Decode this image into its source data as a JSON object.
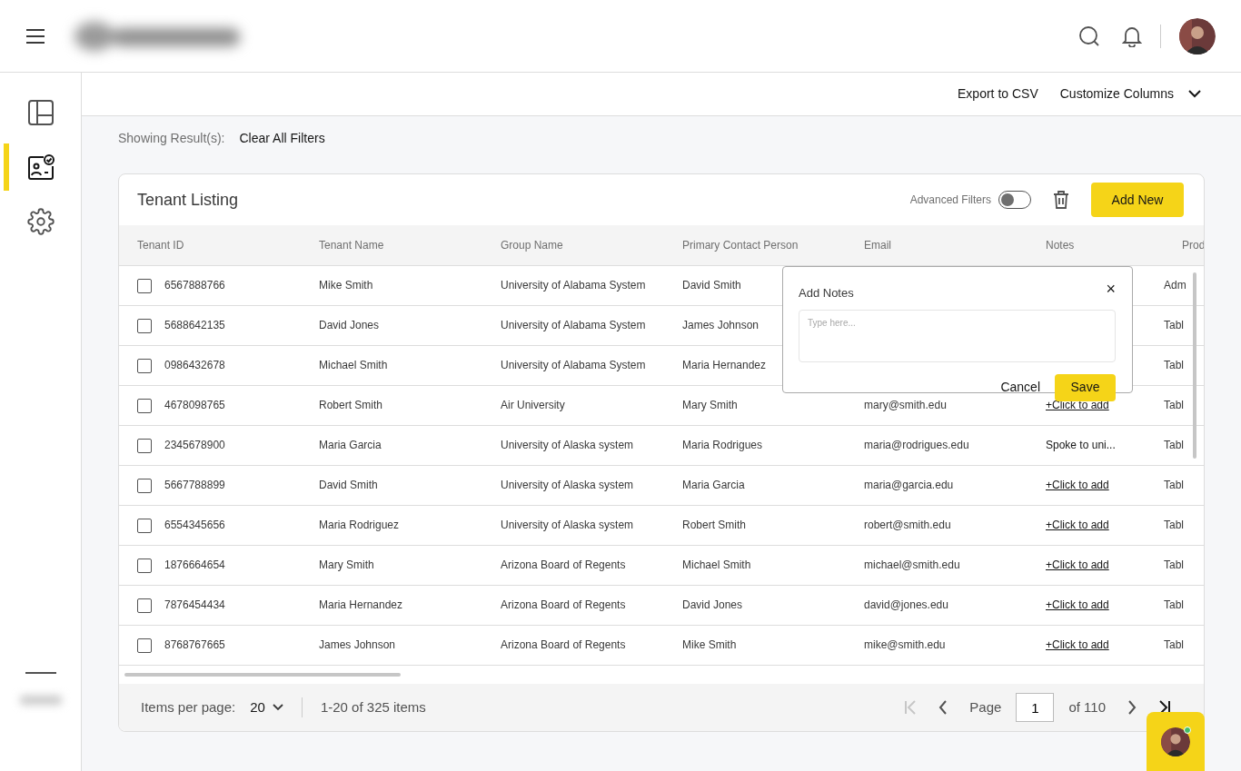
{
  "sidebar": {
    "items": [
      {
        "kind": "layout",
        "selected": false
      },
      {
        "kind": "tenants",
        "selected": true
      },
      {
        "kind": "settings",
        "selected": false
      }
    ]
  },
  "toolbar": {
    "export": "Export to CSV",
    "customize": "Customize Columns"
  },
  "filters": {
    "label": "Showing Result(s):",
    "clear": "Clear All Filters"
  },
  "card": {
    "title": "Tenant Listing",
    "advanced_filters": {
      "label": "Advanced Filters",
      "on": false
    },
    "add_button": "Add New"
  },
  "table": {
    "columns": [
      "Tenant ID",
      "Tenant Name",
      "Group Name",
      "Primary Contact Person",
      "Email",
      "Notes",
      "Prod"
    ],
    "rows": [
      {
        "checked": false,
        "id": "6567888766",
        "name": "Mike Smith",
        "group": "University of Alabama System",
        "contact": "David Smith",
        "column_7": "Adm"
      },
      {
        "checked": false,
        "id": "5688642135",
        "name": "David Jones",
        "group": "University of Alabama System",
        "contact": "James Johnson",
        "column_7": "Tabl"
      },
      {
        "checked": false,
        "id": "0986432678",
        "name": "Michael Smith",
        "group": "University of Alabama System",
        "contact": "Maria Hernandez",
        "column_7": "Tabl"
      },
      {
        "checked": false,
        "id": "4678098765",
        "name": "Robert Smith",
        "group": "Air University",
        "contact": "Mary Smith",
        "email": "mary@smith.edu",
        "notes": {
          "kind": "link",
          "text": "+Click to add"
        },
        "column_7": "Tabl"
      },
      {
        "checked": false,
        "id": "2345678900",
        "name": "Maria Garcia",
        "group": "University of Alaska system",
        "contact": "Maria Rodrigues",
        "email": "maria@rodrigues.edu",
        "notes": {
          "kind": "text",
          "text": "Spoke to uni..."
        },
        "column_7": "Tabl"
      },
      {
        "checked": false,
        "id": "5667788899",
        "name": "David Smith",
        "group": "University of Alaska system",
        "contact": "Maria Garcia",
        "email": "maria@garcia.edu",
        "notes": {
          "kind": "link",
          "text": "+Click to add"
        },
        "column_7": "Tabl"
      },
      {
        "checked": false,
        "id": "6554345656",
        "name": "Maria Rodriguez",
        "group": "University of Alaska system",
        "contact": "Robert Smith",
        "email": "robert@smith.edu",
        "notes": {
          "kind": "link",
          "text": "+Click to add"
        },
        "column_7": "Tabl"
      },
      {
        "checked": false,
        "id": "1876664654",
        "name": "Mary Smith",
        "group": "Arizona Board of Regents",
        "contact": "Michael Smith",
        "email": "michael@smith.edu",
        "notes": {
          "kind": "link",
          "text": "+Click to add"
        },
        "column_7": "Tabl"
      },
      {
        "checked": false,
        "id": "7876454434",
        "name": "Maria Hernandez",
        "group": "Arizona Board of Regents",
        "contact": "David Jones",
        "email": "david@jones.edu",
        "notes": {
          "kind": "link",
          "text": "+Click to add"
        },
        "column_7": "Tabl"
      },
      {
        "checked": false,
        "id": "8768767665",
        "name": "James Johnson",
        "group": "Arizona Board of Regents",
        "contact": "Mike Smith",
        "email": "mike@smith.edu",
        "notes": {
          "kind": "link",
          "text": "+Click to add"
        },
        "column_7": "Tabl"
      }
    ]
  },
  "notes_popup": {
    "title": "Add Notes",
    "close": "×",
    "placeholder": "Type here...",
    "cancel": "Cancel",
    "save": "Save"
  },
  "pagination": {
    "items_per_page_label": "Items per page:",
    "items_per_page": "20",
    "range": "1-20 of 325 items",
    "page_label": "Page",
    "page": "1",
    "of_pages": "of 110",
    "first_disabled": true
  },
  "chat_widget": {
    "online": true
  }
}
